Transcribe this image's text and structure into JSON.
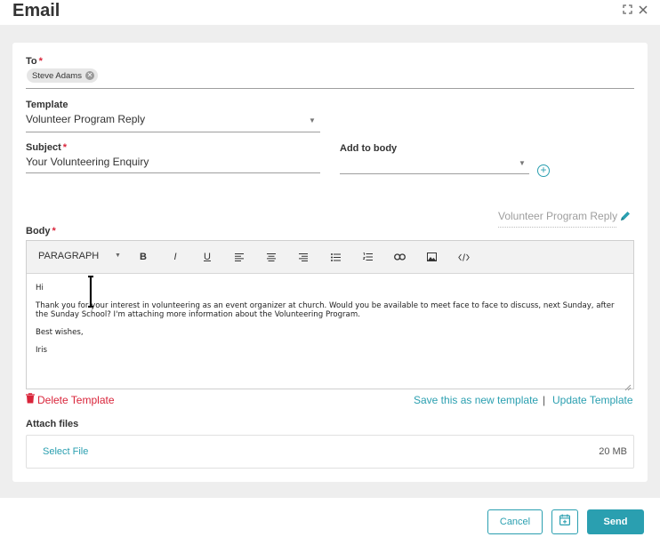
{
  "window": {
    "title": "Email"
  },
  "to": {
    "label": "To",
    "required_mark": "*",
    "recipients": [
      {
        "name": "Steve Adams"
      }
    ]
  },
  "template": {
    "label": "Template",
    "value": "Volunteer Program Reply"
  },
  "subject": {
    "label": "Subject",
    "required_mark": "*",
    "value": "Your Volunteering Enquiry"
  },
  "add_to_body": {
    "label": "Add to body",
    "value": ""
  },
  "body": {
    "label": "Body",
    "required_mark": "*",
    "template_name": "Volunteer Program Reply",
    "toolbar": {
      "paragraph": "PARAGRAPH",
      "bold": "B",
      "italic": "I",
      "underline": "U"
    },
    "content": {
      "line1": "Hi",
      "line2": "Thank you for your interest in volunteering as an event organizer at church. Would you be available to meet face to face to discuss, next Sunday, after the Sunday School? I'm attaching more information about the Volunteering Program.",
      "line3": "Best wishes,",
      "line4": "Iris"
    }
  },
  "template_actions": {
    "delete": "Delete Template",
    "save_new": "Save this as new template",
    "separator": "|",
    "update": "Update Template"
  },
  "attach": {
    "label": "Attach files",
    "select": "Select File",
    "size_limit": "20 MB"
  },
  "footer": {
    "cancel": "Cancel",
    "send": "Send"
  },
  "colors": {
    "accent": "#2a9fb0",
    "danger": "#d9243a"
  }
}
